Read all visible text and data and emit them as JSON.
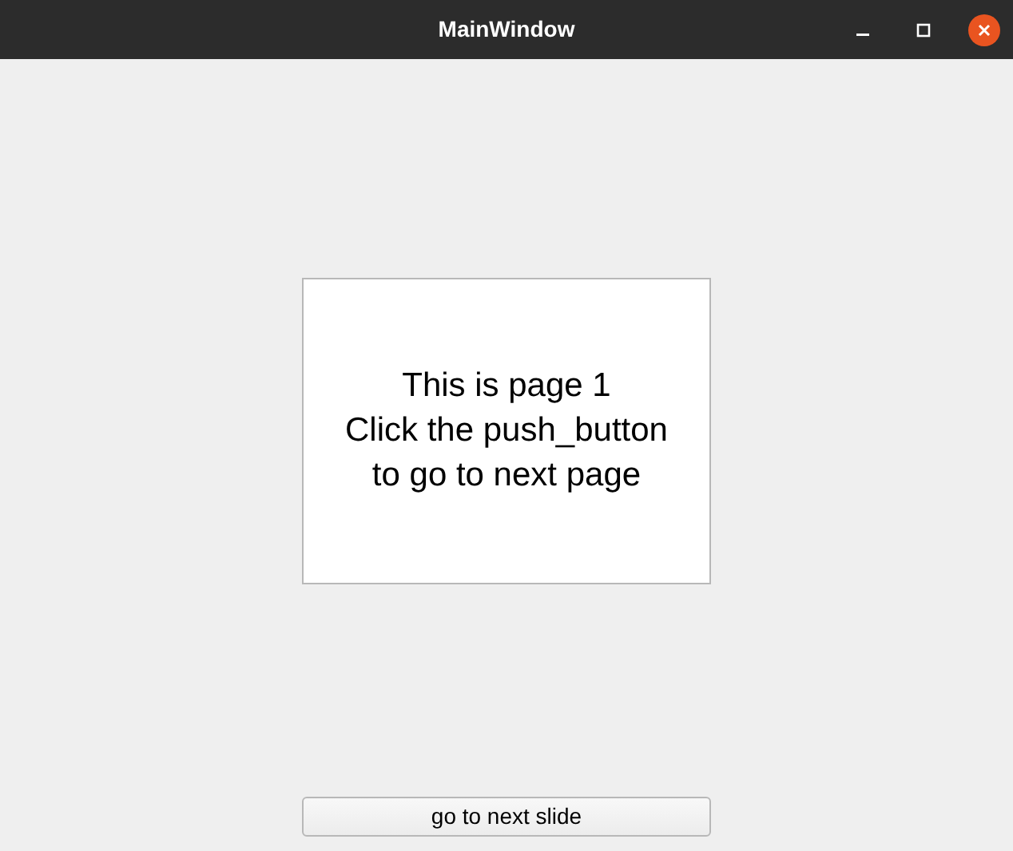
{
  "window": {
    "title": "MainWindow"
  },
  "page": {
    "text": "This is page 1\nClick the push_button\nto go to next page"
  },
  "button": {
    "label": "go to next slide"
  }
}
